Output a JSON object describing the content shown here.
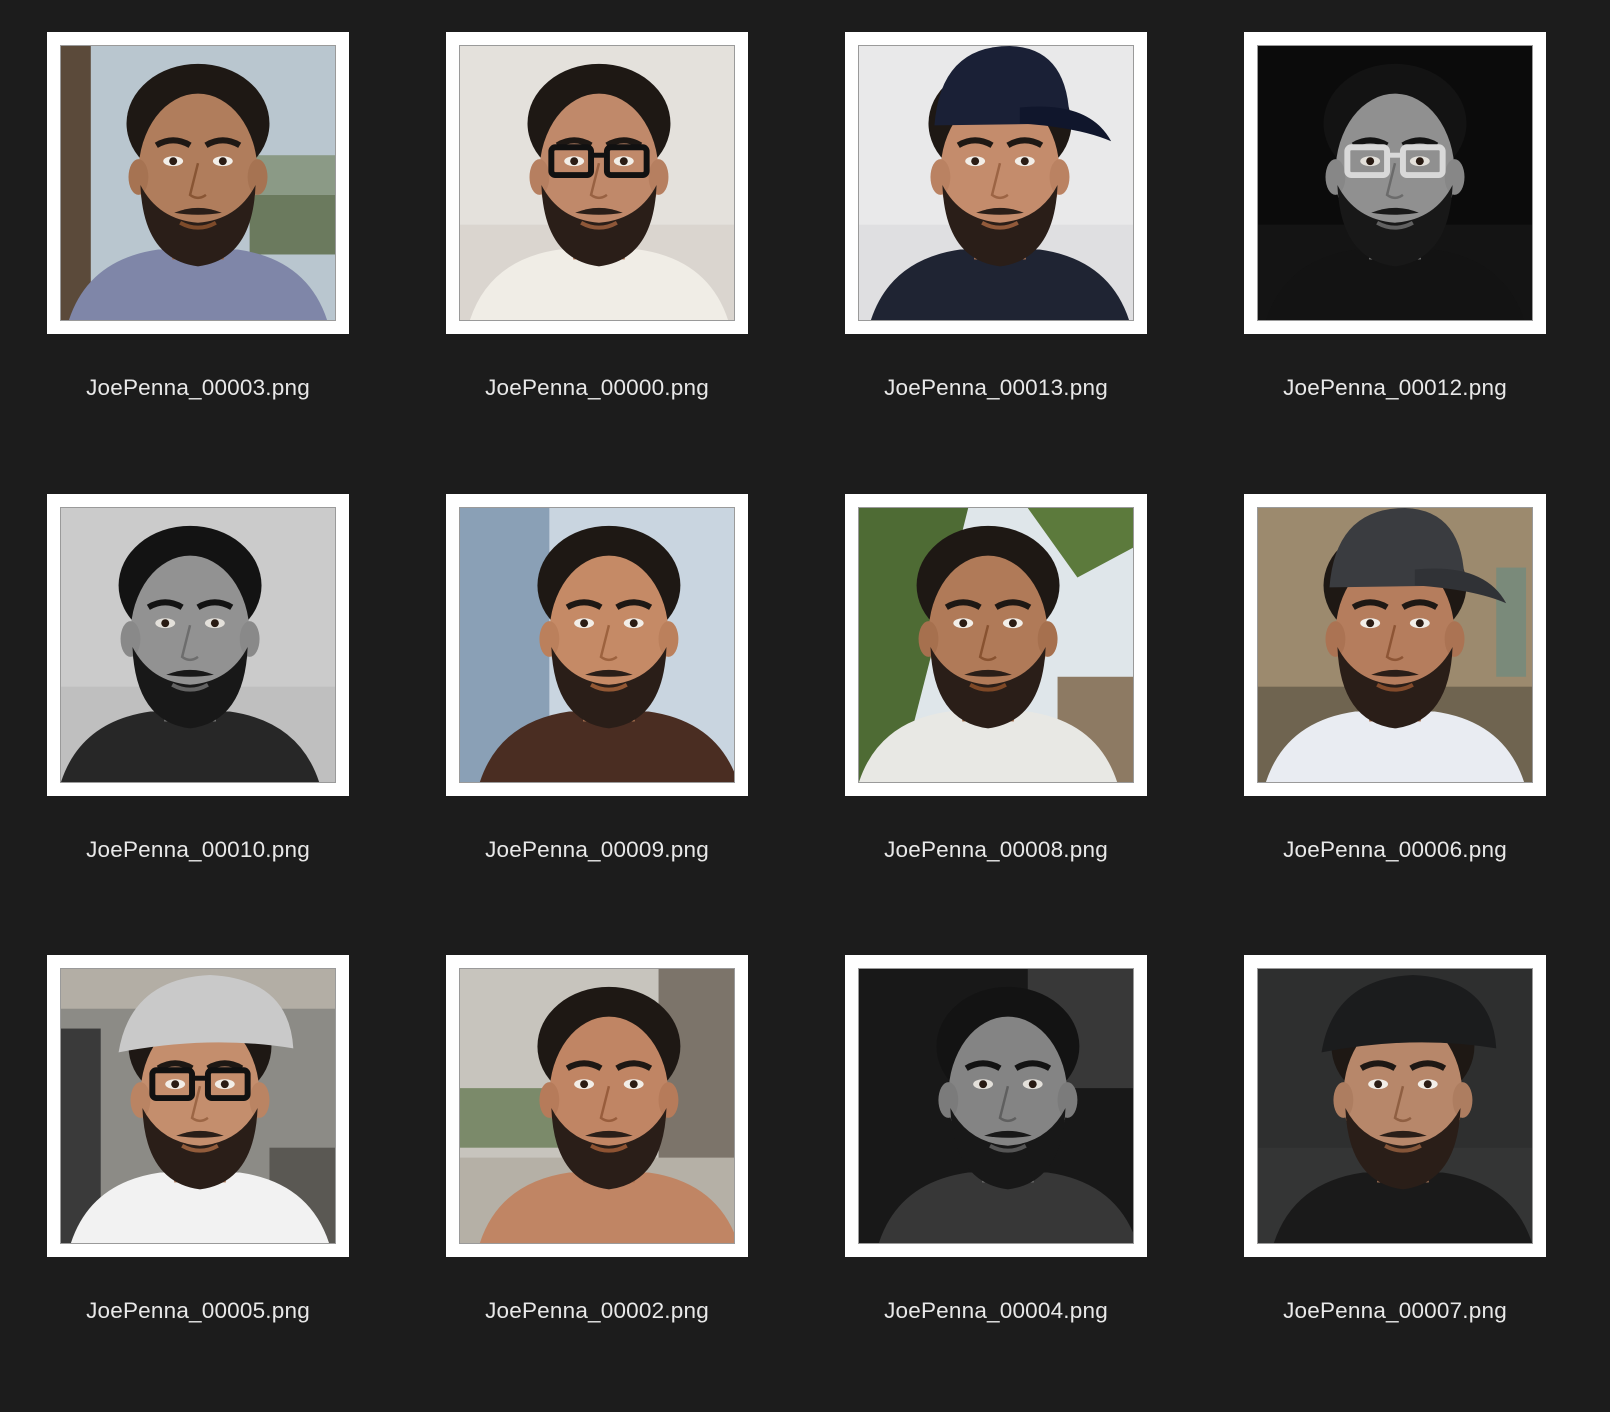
{
  "window": {
    "background": "#1c1c1c"
  },
  "files": [
    {
      "filename": "JoePenna_00003.png",
      "scene": "outdoor-selfie",
      "bg": "#b9c6cf",
      "bg2": "#6b7a5e",
      "tone": "#b07d5c",
      "shirt": "#7f86a8",
      "hat": "none",
      "glasses": "none",
      "mono": false
    },
    {
      "filename": "JoePenna_00000.png",
      "scene": "indoor-selfie",
      "bg": "#e4e1dc",
      "bg2": "#cfcac2",
      "tone": "#c0896a",
      "shirt": "#f0ede6",
      "hat": "none",
      "glasses": "dark",
      "mono": false
    },
    {
      "filename": "JoePenna_00013.png",
      "scene": "studio-portrait",
      "bg": "#e9e9ea",
      "bg2": "#d6d6d8",
      "tone": "#c48c6c",
      "shirt": "#1f2433",
      "hat": "navy-cap",
      "glasses": "none",
      "mono": false
    },
    {
      "filename": "JoePenna_00012.png",
      "scene": "dark-portrait",
      "bg": "#0c0c0c",
      "bg2": "#202020",
      "tone": "#9a9a9a",
      "shirt": "#151515",
      "hat": "none",
      "glasses": "white",
      "mono": true
    },
    {
      "filename": "JoePenna_00010.png",
      "scene": "bw-portrait",
      "bg": "#d8d8d8",
      "bg2": "#bdbdbd",
      "tone": "#9c9c9c",
      "shirt": "#2a2a2a",
      "hat": "none",
      "glasses": "none",
      "mono": true
    },
    {
      "filename": "JoePenna_00009.png",
      "scene": "painted-portrait",
      "bg": "#c9d5e0",
      "bg2": "#8aa0b6",
      "tone": "#c58a66",
      "shirt": "#4a2d22",
      "hat": "none",
      "glasses": "none",
      "mono": false
    },
    {
      "filename": "JoePenna_00008.png",
      "scene": "garden-selfie",
      "bg": "#dfe6ea",
      "bg2": "#4e6b34",
      "tone": "#b07a58",
      "shirt": "#e8e8e4",
      "hat": "none",
      "glasses": "none",
      "mono": false
    },
    {
      "filename": "JoePenna_00006.png",
      "scene": "park-selfie",
      "bg": "#9c8a6e",
      "bg2": "#6f6450",
      "tone": "#b57d5d",
      "shirt": "#e9ecf2",
      "hat": "gray-cap",
      "glasses": "none",
      "mono": false
    },
    {
      "filename": "JoePenna_00005.png",
      "scene": "cafe-selfie",
      "bg": "#8c8b86",
      "bg2": "#5a5853",
      "tone": "#c48e6d",
      "shirt": "#f2f2f2",
      "hat": "flat-cap",
      "glasses": "dark",
      "mono": false
    },
    {
      "filename": "JoePenna_00002.png",
      "scene": "outdoor-shirtless",
      "bg": "#c7c4bd",
      "bg2": "#7b8a6a",
      "tone": "#c08564",
      "shirt": "#c08564",
      "hat": "none",
      "glasses": "none",
      "mono": false
    },
    {
      "filename": "JoePenna_00004.png",
      "scene": "bw-candid",
      "bg": "#1a1a1a",
      "bg2": "#3c3c3c",
      "tone": "#8d8d8d",
      "shirt": "#3b3b3b",
      "hat": "none",
      "glasses": "none",
      "mono": true
    },
    {
      "filename": "JoePenna_00007.png",
      "scene": "dark-flatcap",
      "bg": "#2e2f2f",
      "bg2": "#3a3b3b",
      "tone": "#b7876a",
      "shirt": "#1a1a1a",
      "hat": "dark-flat-cap",
      "glasses": "none",
      "mono": false
    }
  ]
}
